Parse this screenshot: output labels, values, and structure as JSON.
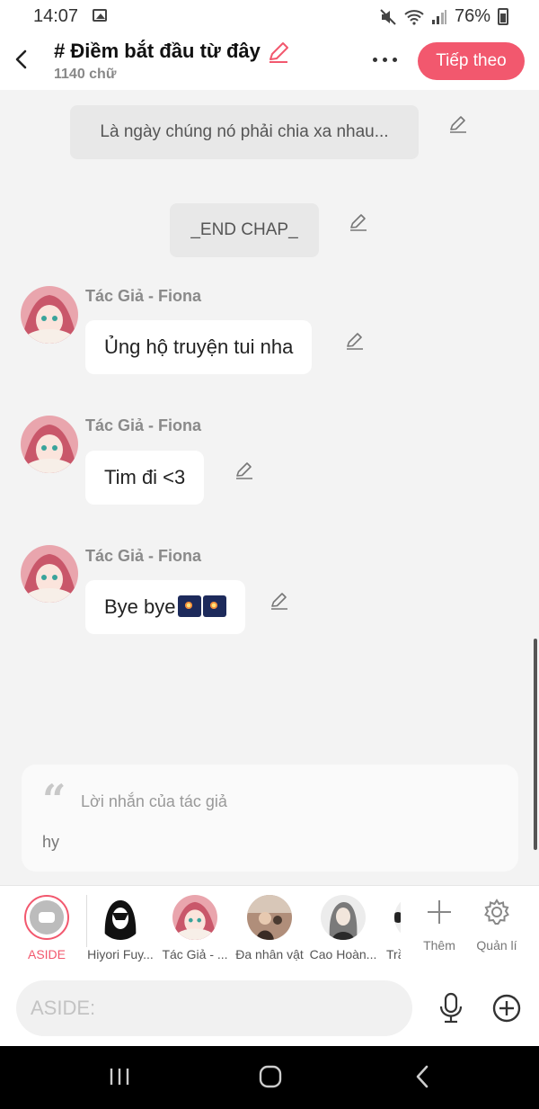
{
  "status": {
    "time": "14:07",
    "battery": "76%"
  },
  "header": {
    "title": "# Điềm bắt đầu từ đây",
    "word_count": "1140 chữ",
    "next_label": "Tiếp theo"
  },
  "messages": {
    "narration_1": "Là ngày chúng nó phải chia xa nhau...",
    "narration_2": "_END CHAP_",
    "author": "Tác Giả - Fiona",
    "msg_1": "Ủng hộ truyện tui nha",
    "msg_2": "Tim đi <3",
    "msg_3": "Bye bye"
  },
  "author_note": {
    "label": "Lời nhắn của tác giả",
    "text": "hy"
  },
  "characters": [
    {
      "label": "ASIDE"
    },
    {
      "label": "Hiyori Fuy..."
    },
    {
      "label": "Tác Giả - ..."
    },
    {
      "label": "Đa nhân vật"
    },
    {
      "label": "Cao Hoàn..."
    },
    {
      "label": "Trầ"
    }
  ],
  "tools": {
    "add_label": "Thêm",
    "manage_label": "Quản lí"
  },
  "input": {
    "placeholder": "ASIDE:"
  },
  "colors": {
    "accent": "#f2586e",
    "background": "#f3f3f3"
  }
}
